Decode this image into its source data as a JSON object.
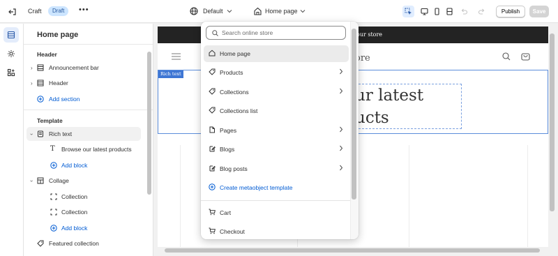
{
  "topbar": {
    "theme_name": "Craft",
    "status_badge": "Draft",
    "more": "•••",
    "context": "Default",
    "page_selector": "Home page",
    "publish_label": "Publish",
    "save_label": "Save"
  },
  "sidebar": {
    "title": "Home page",
    "header_group": "Header",
    "header_items": [
      {
        "label": "Announcement bar"
      },
      {
        "label": "Header"
      }
    ],
    "add_section": "Add section",
    "template_group": "Template",
    "template_items": [
      {
        "label": "Rich text"
      },
      {
        "label": "Browse our latest products"
      },
      {
        "label": "Add block"
      },
      {
        "label": "Collage"
      },
      {
        "label": "Collection"
      },
      {
        "label": "Collection"
      },
      {
        "label": "Add block"
      },
      {
        "label": "Featured collection"
      }
    ]
  },
  "preview": {
    "announcement_text": "our store",
    "store_name": "ore",
    "section_tag": "Rich text",
    "heading_line1": "ur latest",
    "heading_line2": "ucts"
  },
  "dropdown": {
    "search_placeholder": "Search online store",
    "items": [
      {
        "label": "Home page",
        "icon": "home-icon"
      },
      {
        "label": "Products",
        "icon": "tag-icon"
      },
      {
        "label": "Collections",
        "icon": "tag-icon"
      },
      {
        "label": "Collections list",
        "icon": "tag-icon"
      },
      {
        "label": "Pages",
        "icon": "page-icon"
      },
      {
        "label": "Blogs",
        "icon": "blog-icon"
      },
      {
        "label": "Blog posts",
        "icon": "blog-icon"
      },
      {
        "label": "Create metaobject template",
        "icon": "plus-circle-icon"
      },
      {
        "label": "Cart",
        "icon": "cart-icon"
      },
      {
        "label": "Checkout",
        "icon": "cart-icon"
      }
    ]
  },
  "colors": {
    "accent": "#005bd3",
    "selection_outline": "#5b8ddb",
    "announcement_bg": "#232323",
    "draft_badge_bg": "#cce5ff"
  }
}
